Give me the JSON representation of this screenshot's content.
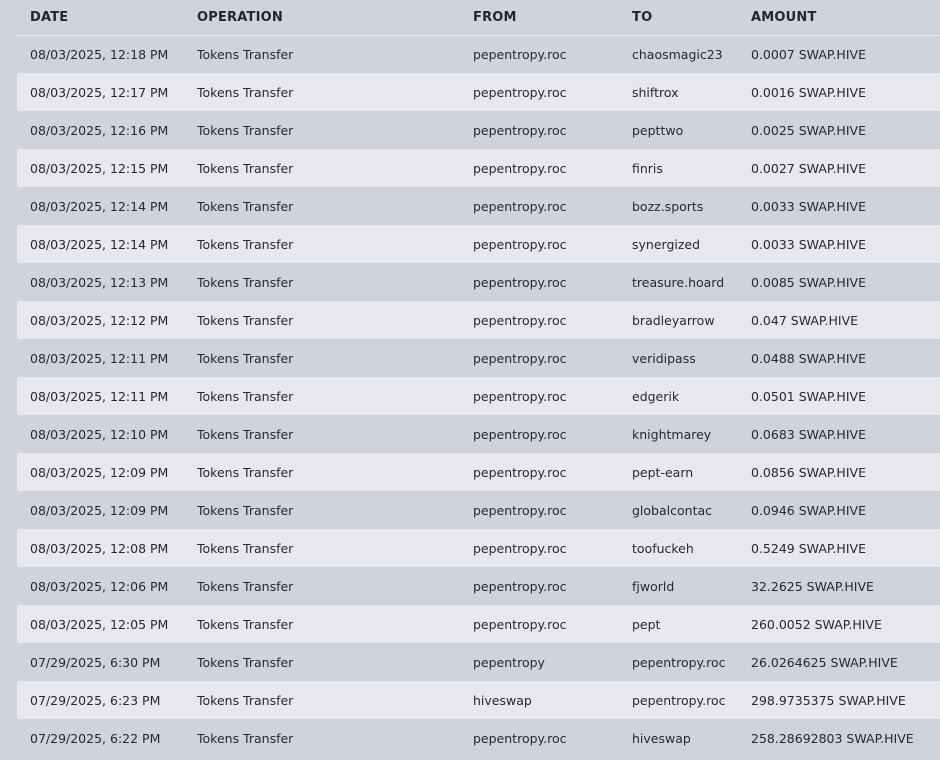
{
  "table": {
    "headers": {
      "date": "DATE",
      "operation": "OPERATION",
      "from": "FROM",
      "to": "TO",
      "amount": "AMOUNT"
    },
    "rows": [
      {
        "date": "08/03/2025, 12:18 PM",
        "operation": "Tokens Transfer",
        "from": "pepentropy.roc",
        "to": "chaosmagic23",
        "amount": "0.0007 SWAP.HIVE"
      },
      {
        "date": "08/03/2025, 12:17 PM",
        "operation": "Tokens Transfer",
        "from": "pepentropy.roc",
        "to": "shiftrox",
        "amount": "0.0016 SWAP.HIVE"
      },
      {
        "date": "08/03/2025, 12:16 PM",
        "operation": "Tokens Transfer",
        "from": "pepentropy.roc",
        "to": "pepttwo",
        "amount": "0.0025 SWAP.HIVE"
      },
      {
        "date": "08/03/2025, 12:15 PM",
        "operation": "Tokens Transfer",
        "from": "pepentropy.roc",
        "to": "finris",
        "amount": "0.0027 SWAP.HIVE"
      },
      {
        "date": "08/03/2025, 12:14 PM",
        "operation": "Tokens Transfer",
        "from": "pepentropy.roc",
        "to": "bozz.sports",
        "amount": "0.0033 SWAP.HIVE"
      },
      {
        "date": "08/03/2025, 12:14 PM",
        "operation": "Tokens Transfer",
        "from": "pepentropy.roc",
        "to": "synergized",
        "amount": "0.0033 SWAP.HIVE"
      },
      {
        "date": "08/03/2025, 12:13 PM",
        "operation": "Tokens Transfer",
        "from": "pepentropy.roc",
        "to": "treasure.hoard",
        "amount": "0.0085 SWAP.HIVE"
      },
      {
        "date": "08/03/2025, 12:12 PM",
        "operation": "Tokens Transfer",
        "from": "pepentropy.roc",
        "to": "bradleyarrow",
        "amount": "0.047 SWAP.HIVE"
      },
      {
        "date": "08/03/2025, 12:11 PM",
        "operation": "Tokens Transfer",
        "from": "pepentropy.roc",
        "to": "veridipass",
        "amount": "0.0488 SWAP.HIVE"
      },
      {
        "date": "08/03/2025, 12:11 PM",
        "operation": "Tokens Transfer",
        "from": "pepentropy.roc",
        "to": "edgerik",
        "amount": "0.0501 SWAP.HIVE"
      },
      {
        "date": "08/03/2025, 12:10 PM",
        "operation": "Tokens Transfer",
        "from": "pepentropy.roc",
        "to": "knightmarey",
        "amount": "0.0683 SWAP.HIVE"
      },
      {
        "date": "08/03/2025, 12:09 PM",
        "operation": "Tokens Transfer",
        "from": "pepentropy.roc",
        "to": "pept-earn",
        "amount": "0.0856 SWAP.HIVE"
      },
      {
        "date": "08/03/2025, 12:09 PM",
        "operation": "Tokens Transfer",
        "from": "pepentropy.roc",
        "to": "globalcontac",
        "amount": "0.0946 SWAP.HIVE"
      },
      {
        "date": "08/03/2025, 12:08 PM",
        "operation": "Tokens Transfer",
        "from": "pepentropy.roc",
        "to": "toofuckeh",
        "amount": "0.5249 SWAP.HIVE"
      },
      {
        "date": "08/03/2025, 12:06 PM",
        "operation": "Tokens Transfer",
        "from": "pepentropy.roc",
        "to": "fjworld",
        "amount": "32.2625 SWAP.HIVE"
      },
      {
        "date": "08/03/2025, 12:05 PM",
        "operation": "Tokens Transfer",
        "from": "pepentropy.roc",
        "to": "pept",
        "amount": "260.0052 SWAP.HIVE"
      },
      {
        "date": "07/29/2025, 6:30 PM",
        "operation": "Tokens Transfer",
        "from": "pepentropy",
        "to": "pepentropy.roc",
        "amount": "26.0264625 SWAP.HIVE"
      },
      {
        "date": "07/29/2025, 6:23 PM",
        "operation": "Tokens Transfer",
        "from": "hiveswap",
        "to": "pepentropy.roc",
        "amount": "298.9735375 SWAP.HIVE"
      },
      {
        "date": "07/29/2025, 6:22 PM",
        "operation": "Tokens Transfer",
        "from": "pepentropy.roc",
        "to": "hiveswap",
        "amount": "258.28692803 SWAP.HIVE"
      }
    ]
  }
}
